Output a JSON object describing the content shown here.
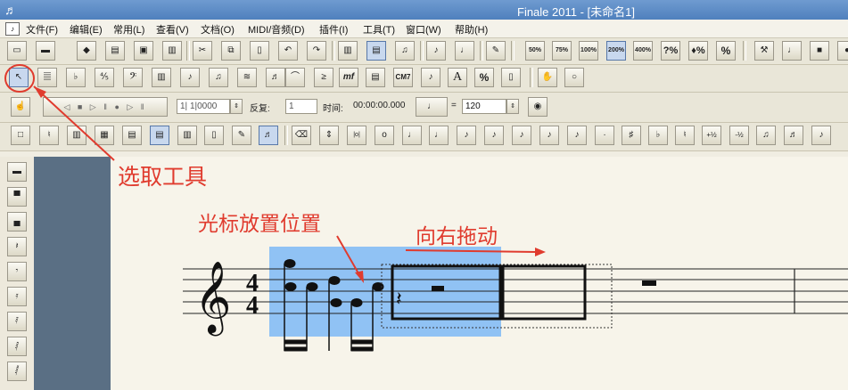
{
  "window": {
    "title": "Finale 2011 - [未命名1]"
  },
  "menu": [
    "文件(F)",
    "编辑(E)",
    "常用(L)",
    "查看(V)",
    "文档(O)",
    "MIDI/音频(D)",
    "插件(I)",
    "工具(T)",
    "窗口(W)",
    "帮助(H)"
  ],
  "toolbar_zoom": [
    "50%",
    "75%",
    "100%",
    "200%",
    "400%",
    "?%",
    "♦%",
    "%"
  ],
  "playback": {
    "position": "1| 1|0000",
    "repeat_label": "反复:",
    "repeat_value": "1",
    "time_label": "时间:",
    "time_value": "00:00:00.000",
    "equals": "=",
    "tempo": "120"
  },
  "tool_text_buttons": {
    "cm7": "CM7",
    "mf": "mf",
    "a": "A",
    "pct": "%"
  },
  "annotations": {
    "select_tool": "选取工具",
    "cursor_position": "光标放置位置",
    "drag_right": "向右拖动"
  },
  "score": {
    "time_signature_top": "4",
    "time_signature_bottom": "4"
  },
  "colors": {
    "annotation": "#e03b2e",
    "selection": "#90c2f4",
    "titlebar": "#5a88c4"
  }
}
